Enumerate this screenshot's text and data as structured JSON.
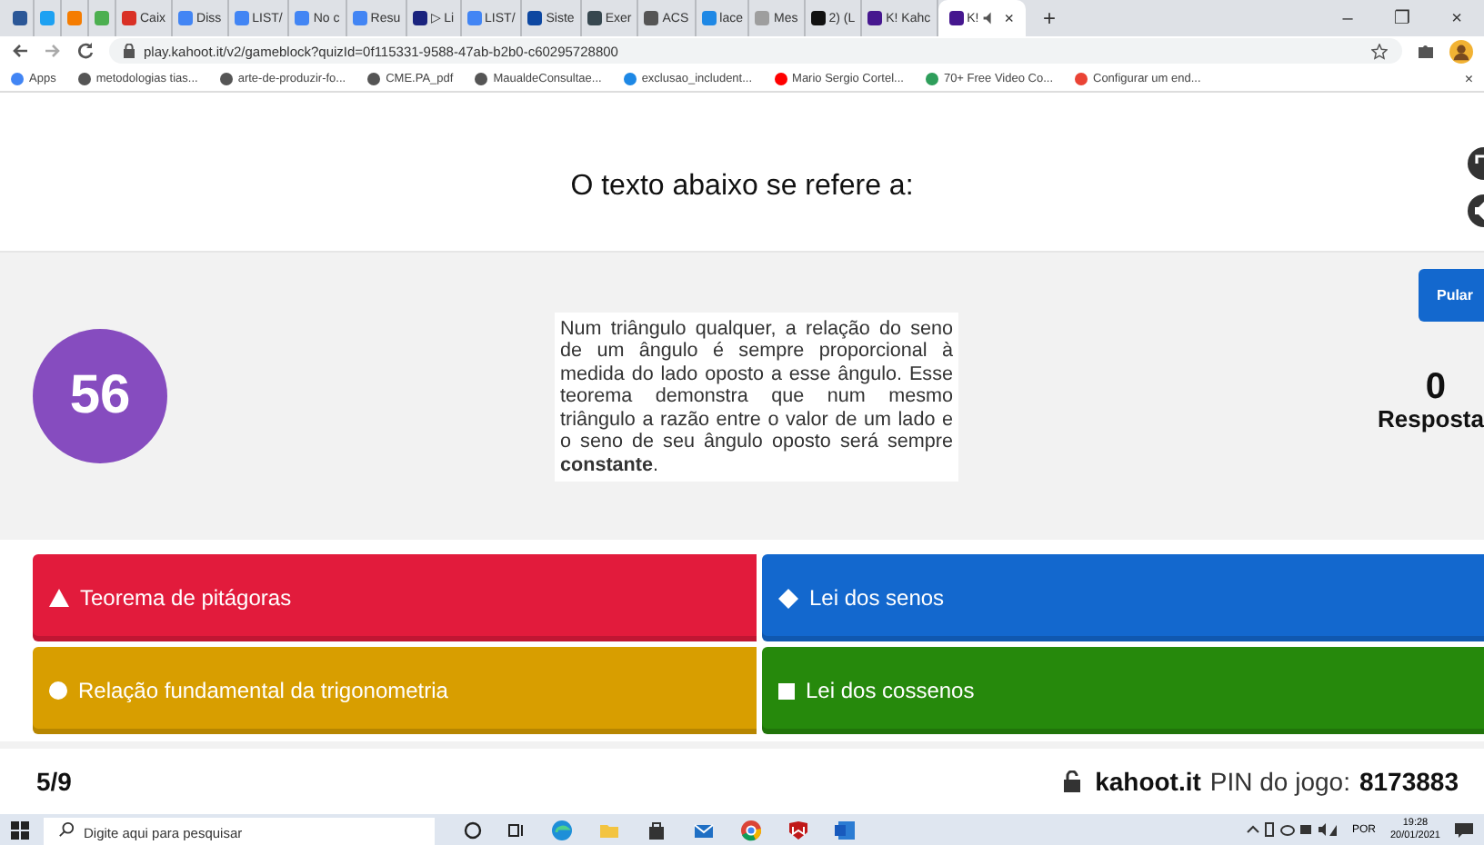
{
  "browser": {
    "tabs": [
      {
        "color": "#2b5797",
        "selected": false
      },
      {
        "color": "#1da1f2",
        "selected": false
      },
      {
        "color": "#f57c00",
        "selected": false
      },
      {
        "color": "#4caf50",
        "selected": false
      },
      {
        "label": "Caix",
        "color": "#d93025",
        "selected": false
      },
      {
        "label": "Diss",
        "color": "#4285f4",
        "selected": false
      },
      {
        "label": "LIST/",
        "color": "#4285f4",
        "selected": false
      },
      {
        "label": "No c",
        "color": "#4285f4",
        "selected": false
      },
      {
        "label": "Resu",
        "color": "#4285f4",
        "selected": false
      },
      {
        "label": "▷ Li",
        "color": "#1a237e",
        "selected": false
      },
      {
        "label": "LIST/",
        "color": "#4285f4",
        "selected": false
      },
      {
        "label": "Siste",
        "color": "#0d47a1",
        "selected": false
      },
      {
        "label": "Exer",
        "color": "#37474f",
        "selected": false
      },
      {
        "label": "ACS",
        "color": "#555555",
        "selected": false
      },
      {
        "label": "lace",
        "color": "#1e88e5",
        "selected": false
      },
      {
        "label": "Mes",
        "color": "#9e9e9e",
        "selected": false
      },
      {
        "label": "2) (L",
        "color": "#111111",
        "selected": false
      },
      {
        "label": "K! Kahc",
        "color": "#46178f",
        "selected": false
      },
      {
        "label": "K!",
        "color": "#46178f",
        "selected": true
      }
    ],
    "close_tab": "×",
    "new_tab": "+",
    "window_controls": [
      "–",
      "❐",
      "×"
    ],
    "address": "play.kahoot.it/v2/gameblock?quizId=0f115331-9588-47ab-b2b0-c60295728800",
    "bookmarks": [
      {
        "label": "Apps",
        "color": "#4285f4"
      },
      {
        "label": "metodologias tias...",
        "color": "#555555"
      },
      {
        "label": "arte-de-produzir-fo...",
        "color": "#555555"
      },
      {
        "label": "CME.PA_pdf",
        "color": "#555555"
      },
      {
        "label": "MaualdeConsultae...",
        "color": "#555555"
      },
      {
        "label": "exclusao_includent...",
        "color": "#1e88e5"
      },
      {
        "label": "Mario Sergio Cortel...",
        "color": "#ff0000"
      },
      {
        "label": "70+ Free Video Co...",
        "color": "#2e9e5b"
      },
      {
        "label": "Configurar um end...",
        "color": "#ea4335"
      }
    ],
    "bookmarks_close": "×"
  },
  "question": {
    "title": "O texto abaixo se refere a:",
    "timer": "56",
    "skip": "Pular",
    "answers_count": "0",
    "answers_label": "Resposta",
    "text": "Num triângulo qualquer, a relação do seno de um ângulo é sempre proporcional à medida do lado oposto a esse ângulo. Esse teorema demonstra que num mesmo triângulo a razão entre o valor de um lado e o seno de seu ângulo oposto será sempre **constante**."
  },
  "answers": [
    {
      "kind": "triangle",
      "label": "Teorema de pitágoras",
      "color": "#e21b3c"
    },
    {
      "kind": "diamond",
      "label": "Lei dos senos",
      "color": "#1368ce"
    },
    {
      "kind": "circle",
      "label": "Relação fundamental da trigonometria",
      "color": "#d89e00"
    },
    {
      "kind": "square",
      "label": "Lei dos cossenos",
      "color": "#26890c"
    }
  ],
  "footer": {
    "progress": "5/9",
    "site": "kahoot.it",
    "pin_label": "PIN do jogo:",
    "pin": "8173883"
  },
  "taskbar": {
    "search_placeholder": "Digite aqui para pesquisar",
    "language": "POR",
    "time": "19:28",
    "date": "20/01/2021"
  }
}
